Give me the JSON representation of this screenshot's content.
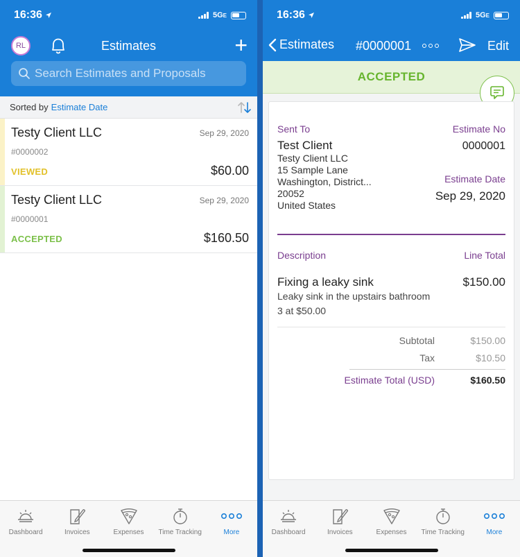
{
  "status_bar": {
    "time": "16:36",
    "network": "5G",
    "network_suffix": "E"
  },
  "left": {
    "avatar_initials": "RL",
    "title": "Estimates",
    "search_placeholder": "Search Estimates and Proposals",
    "sort_prefix": "Sorted by",
    "sort_value": "Estimate Date",
    "estimates": [
      {
        "client": "Testy Client LLC",
        "date": "Sep 29, 2020",
        "number": "#0000002",
        "status": "VIEWED",
        "status_color": "#e2c12a",
        "amount": "$60.00"
      },
      {
        "client": "Testy Client LLC",
        "date": "Sep 29, 2020",
        "number": "#0000001",
        "status": "ACCEPTED",
        "status_color": "#7cc04a",
        "amount": "$160.50"
      }
    ]
  },
  "right": {
    "back_label": "Estimates",
    "title": "#0000001",
    "edit_label": "Edit",
    "status_banner": "ACCEPTED",
    "sent_to_label": "Sent To",
    "estimate_no_label": "Estimate No",
    "client_name": "Test Client",
    "address": [
      "Testy Client LLC",
      "15 Sample Lane",
      "Washington, District...",
      "20052",
      "United States"
    ],
    "estimate_no": "0000001",
    "estimate_date_label": "Estimate Date",
    "estimate_date": "Sep 29, 2020",
    "description_label": "Description",
    "line_total_label": "Line Total",
    "item": {
      "name": "Fixing a leaky sink",
      "description": "Leaky sink in the upstairs bathroom",
      "qty": "3 at $50.00",
      "total": "$150.00"
    },
    "subtotal_label": "Subtotal",
    "subtotal": "$150.00",
    "tax_label": "Tax",
    "tax": "$10.50",
    "total_label": "Estimate Total (USD)",
    "total": "$160.50"
  },
  "tabs": [
    {
      "label": "Dashboard",
      "icon": "dashboard-sunrise-icon"
    },
    {
      "label": "Invoices",
      "icon": "invoice-quill-icon"
    },
    {
      "label": "Expenses",
      "icon": "expenses-pizza-icon"
    },
    {
      "label": "Time Tracking",
      "icon": "stopwatch-icon"
    },
    {
      "label": "More",
      "icon": "more-dots-icon"
    }
  ],
  "colors": {
    "brand_blue": "#1a7fd8",
    "accepted_green": "#67b52e",
    "viewed_yellow": "#e2c12a",
    "purple_label": "#7a3e8f"
  }
}
